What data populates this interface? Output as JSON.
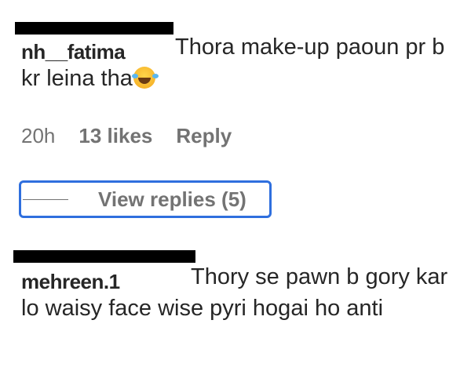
{
  "comments": [
    {
      "username": "nh__fatima",
      "text": "Thora make-up paoun pr b kr leina tha",
      "emoji": "face-with-tears-of-joy"
    },
    {
      "username": "mehreen.1",
      "text": "Thory se pawn b gory kar lo waisy face wise pyri hogai ho anti"
    }
  ],
  "meta": {
    "time": "20h",
    "likes": "13 likes",
    "reply": "Reply"
  },
  "view_replies": {
    "label": "View replies (5)"
  },
  "colors": {
    "text": "#262626",
    "muted": "#737373",
    "focus": "#2f6fde"
  }
}
